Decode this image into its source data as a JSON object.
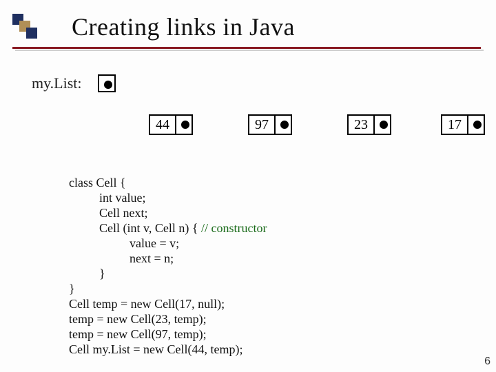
{
  "slide": {
    "title": "Creating links in Java",
    "page_number": "6"
  },
  "list": {
    "var_label": "my.List:",
    "nodes": [
      "44",
      "97",
      "23",
      "17"
    ]
  },
  "code": {
    "l1": "class Cell {",
    "l2": "int value;",
    "l3": "Cell next;",
    "l4a": "Cell (int v, Cell n) { ",
    "l4b": "// constructor",
    "l5": "value = v;",
    "l6": "next = n;",
    "l7": "}",
    "l8": "}",
    "l9": "Cell temp = new Cell(17, null);",
    "l10": "temp = new Cell(23, temp);",
    "l11": "temp = new Cell(97, temp);",
    "l12": "Cell my.List = new Cell(44, temp);"
  }
}
